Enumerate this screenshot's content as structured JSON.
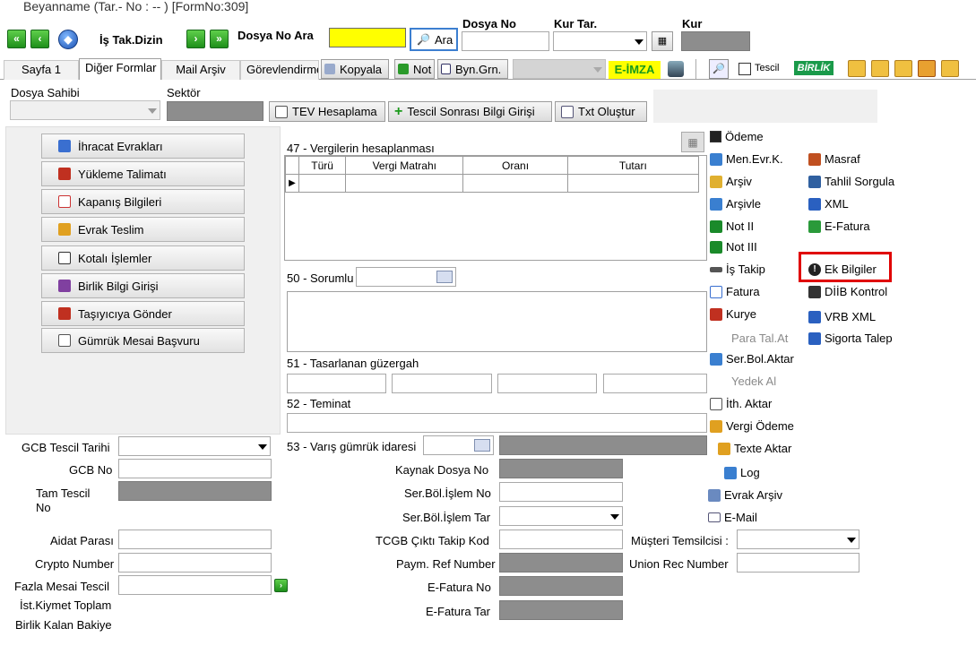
{
  "window": {
    "title": "Beyanname (Tar.- No :  --  ) [FormNo:309]"
  },
  "toolbar": {
    "is_takip_dizin": "İş Tak.Dizin",
    "dosya_no_ara_label": "Dosya No Ara",
    "ara_button": "Ara",
    "dosya_no_label": "Dosya No",
    "kur_tar_label": "Kur Tar.",
    "kur_label": "Kur"
  },
  "tabs": [
    "Sayfa 1",
    "Diğer Formlar",
    "Mail Arşiv",
    "Görevlendirme"
  ],
  "tab_actions": {
    "kopyala": "Kopyala",
    "not": "Not",
    "byn_grn": "Byn.Grn.",
    "e_imza": "E-İMZA",
    "tescil": "Tescil",
    "birlik": "BİRLİK"
  },
  "header_fields": {
    "dosya_sahibi": "Dosya Sahibi",
    "sektor": "Sektör",
    "tev_hesaplama": "TEV Hesaplama",
    "tescil_sonrasi": "Tescil Sonrası Bilgi Girişi",
    "txt_olustur": "Txt Oluştur"
  },
  "left_buttons": [
    "İhracat Evrakları",
    "Yükleme Talimatı",
    "Kapanış Bilgileri",
    "Evrak Teslim",
    "Kotalı İşlemler",
    "Birlik Bilgi Girişi",
    "Taşıyıcıya Gönder",
    "Gümrük Mesai Başvuru"
  ],
  "vergi_section": {
    "title": "47 - Vergilerin hesaplanması",
    "columns": [
      "Türü",
      "Vergi Matrahı",
      "Oranı",
      "Tutarı"
    ]
  },
  "sorumlu_label": "50 - Sorumlu",
  "guzergah_label": "51 - Tasarlanan güzergah",
  "teminat_label": "52 - Teminat",
  "varis_label": "53 - Varış gümrük idaresi",
  "right_links": {
    "odeme": "Ödeme",
    "men_evr": "Men.Evr.K.",
    "masraf": "Masraf",
    "arsiv": "Arşiv",
    "tahlil_sorgula": "Tahlil Sorgula",
    "arsivle": "Arşivle",
    "xml": "XML",
    "not_ii": "Not II",
    "e_fatura": "E-Fatura",
    "not_iii": "Not III",
    "is_takip": "İş Takip",
    "ek_bilgiler": "Ek Bilgiler",
    "fatura": "Fatura",
    "diib_kontrol": "DİİB Kontrol",
    "kurye": "Kurye",
    "vrb_xml": "VRB XML",
    "para_tal_at": "Para Tal.At",
    "sigorta_talep": "Sigorta Talep",
    "ser_bol_aktar": "Ser.Bol.Aktar",
    "yedek_al": "Yedek Al",
    "ith_aktar": "İth. Aktar",
    "vergi_odeme": "Vergi Ödeme",
    "texte_aktar": "Texte Aktar",
    "log": "Log",
    "evrak_arsiv": "Evrak Arşiv",
    "e_mail": "E-Mail"
  },
  "bottom_left": {
    "gcb_tescil_tarihi": "GCB Tescil Tarihi",
    "gcb_no": "GCB No",
    "tam_tescil_no": "Tam Tescil\nNo",
    "aidat_parasi": "Aidat Parası",
    "crypto_number": "Crypto Number",
    "fazla_mesai": "Fazla Mesai Tescil",
    "ist_kiymet": "İst.Kiymet Toplam",
    "birlik_kalan": "Birlik Kalan Bakiye"
  },
  "bottom_mid": {
    "kaynak_dosya_no": "Kaynak Dosya No",
    "ser_bol_islem_no": "Ser.Böl.İşlem No",
    "ser_bol_islem_tar": "Ser.Böl.İşlem Tar",
    "tcgb_cikti": "TCGB Çıktı Takip Kod",
    "paym_ref": "Paym. Ref Number",
    "efatura_no": "E-Fatura No",
    "efatura_tar": "E-Fatura Tar"
  },
  "bottom_right": {
    "musteri_temsilcisi": "Müşteri Temsilcisi :",
    "union_rec": "Union Rec Number"
  },
  "colors": {
    "highlight": "#e00000",
    "yellow_field": "#ffff00",
    "green_button": "#1e8f1a",
    "disabled_gray": "#8d8d8d"
  }
}
